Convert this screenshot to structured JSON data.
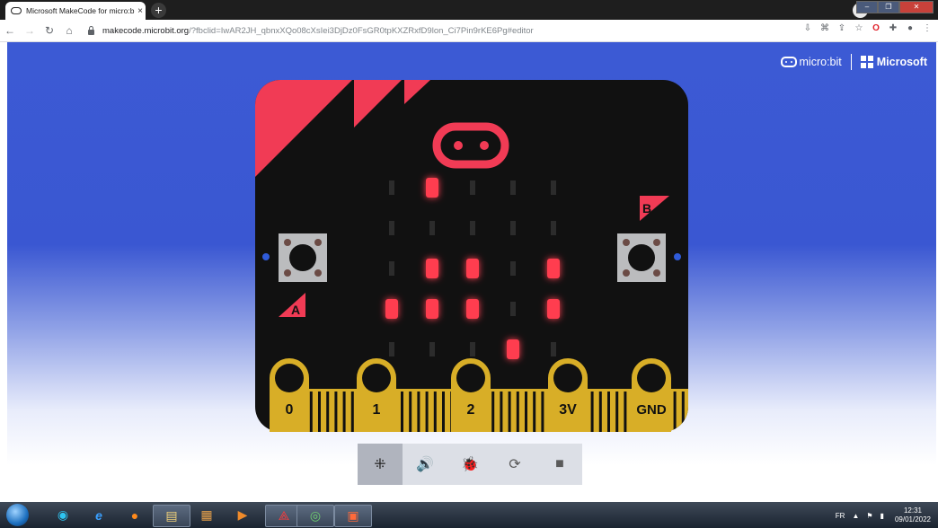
{
  "browser": {
    "tab_title": "Microsoft MakeCode for micro:bit",
    "tab_close": "×",
    "new_tab": "+",
    "tabs_dropdown": "⌄",
    "url_domain": "makecode.microbit.org",
    "url_path": "/?fbclid=IwAR2JH_qbnxXQo08cXsIei3DjDz0FsGR0tpKXZRxfD9lon_Ci7Pin9rKE6Pg#editor",
    "window_buttons": [
      "–",
      "❐",
      "✕"
    ]
  },
  "header": {
    "microbit_label": "micro:bit",
    "microsoft_label": "Microsoft"
  },
  "board": {
    "colors": {
      "board": "#111111",
      "accent": "#f13b55",
      "gold": "#d8ae27",
      "led_on": "#ff3d4f",
      "led_off": "#2c2c2c"
    },
    "button_labels": {
      "a": "A",
      "b": "B"
    },
    "pins": [
      "0",
      "1",
      "2",
      "3V",
      "GND"
    ],
    "leds": [
      [
        0,
        1,
        0,
        0,
        0
      ],
      [
        0,
        0,
        0,
        0,
        0
      ],
      [
        0,
        1,
        1,
        0,
        1
      ],
      [
        1,
        1,
        1,
        0,
        1
      ],
      [
        0,
        0,
        0,
        1,
        0
      ]
    ]
  },
  "controls": {
    "items": [
      {
        "name": "simulator-mode",
        "icon": "⁜",
        "active": true
      },
      {
        "name": "mute-audio",
        "icon": "🔊",
        "active": false
      },
      {
        "name": "debug",
        "icon": "🐞",
        "active": false
      },
      {
        "name": "restart",
        "icon": "⟳",
        "active": false
      },
      {
        "name": "stop",
        "icon": "■",
        "active": false
      }
    ]
  },
  "taskbar": {
    "lang": "FR",
    "time": "12:31",
    "date": "09/01/2022",
    "apps": [
      "edge-icon",
      "ie-icon",
      "firefox-icon",
      "file-explorer-icon",
      "archive-icon",
      "media-player-icon",
      "acrobat-icon",
      "chrome-icon",
      "presentation-icon"
    ]
  }
}
